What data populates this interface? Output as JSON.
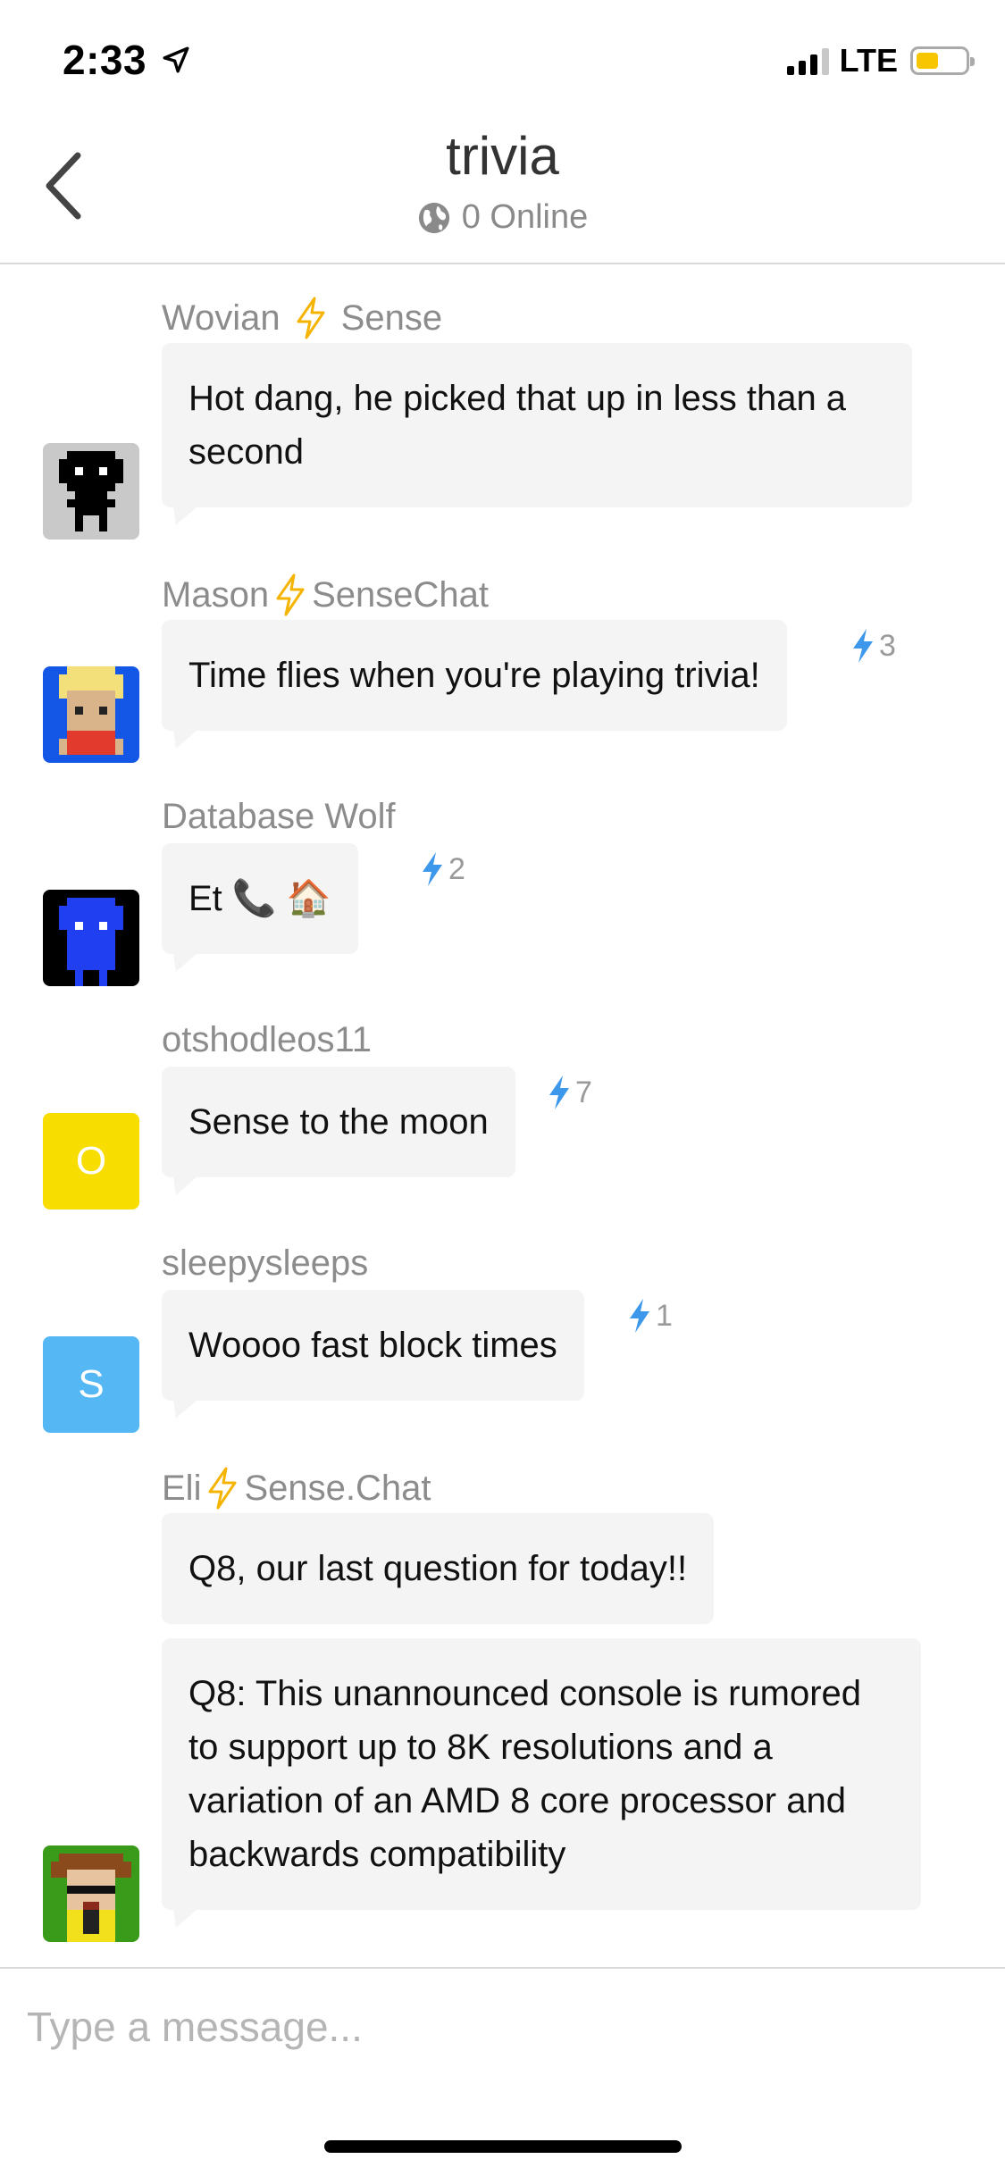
{
  "status_bar": {
    "time": "2:33",
    "network": "LTE",
    "battery_level": 0.45
  },
  "header": {
    "title": "trivia",
    "online_text": "0 Online"
  },
  "colors": {
    "bolt_orange": "#f5b400",
    "bolt_blue": "#3d97ea",
    "bubble_bg": "#f4f4f4"
  },
  "messages": [
    {
      "author_parts": [
        "Wovian",
        "Sense"
      ],
      "text": "Hot dang, he picked that up in less than a second",
      "reaction": "",
      "avatar": {
        "kind": "pixel-black",
        "letter": ""
      }
    },
    {
      "author_parts": [
        "Mason",
        "SenseChat"
      ],
      "text": "Time flies when you're playing trivia!",
      "reaction": "3",
      "avatar": {
        "kind": "pixel-blonde",
        "letter": ""
      }
    },
    {
      "author_parts": [
        "Database Wolf"
      ],
      "text": "Et 📞 🏠",
      "reaction": "2",
      "avatar": {
        "kind": "pixel-blue",
        "letter": ""
      }
    },
    {
      "author_parts": [
        "otshodleos11"
      ],
      "text": "Sense to the moon",
      "reaction": "7",
      "avatar": {
        "kind": "letter",
        "letter": "O",
        "color": "#f7dd00"
      }
    },
    {
      "author_parts": [
        "sleepysleeps"
      ],
      "text": "Woooo fast block times",
      "reaction": "1",
      "avatar": {
        "kind": "letter",
        "letter": "S",
        "color": "#55b8f5"
      }
    },
    {
      "author_parts": [
        "Eli",
        "Sense.Chat"
      ],
      "text": "Q8, our last question for today!!",
      "reaction": "",
      "avatar": null
    },
    {
      "author_parts": [],
      "text": "Q8: This unannounced console is rumored to support up to 8K resolutions and a variation of an AMD 8 core processor and backwards compatibility",
      "reaction": "",
      "avatar": {
        "kind": "pixel-glasses",
        "letter": ""
      }
    }
  ],
  "composer": {
    "placeholder": "Type a message..."
  }
}
